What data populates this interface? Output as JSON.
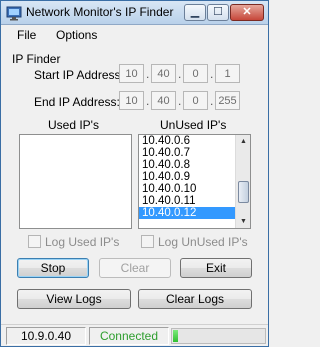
{
  "window": {
    "title": "Network Monitor's IP Finder"
  },
  "menu": {
    "file": "File",
    "options": "Options"
  },
  "ip_finder": {
    "group_label": "IP Finder",
    "start_label": "Start IP Address:",
    "end_label": "End IP Address:",
    "start_octets": [
      "10",
      "40",
      "0",
      "1"
    ],
    "end_octets": [
      "10",
      "40",
      "0",
      "255"
    ],
    "separator": "."
  },
  "used": {
    "label": "Used IP's",
    "items": []
  },
  "unused": {
    "label": "UnUsed IP's",
    "items": [
      "10.40.0.6",
      "10.40.0.7",
      "10.40.0.8",
      "10.40.0.9",
      "10.40.0.10",
      "10.40.0.11",
      "10.40.0.12"
    ],
    "selected": "10.40.0.12"
  },
  "checkboxes": {
    "log_used": "Log Used IP's",
    "log_unused": "Log UnUsed IP's"
  },
  "buttons": {
    "stop": "Stop",
    "clear": "Clear",
    "exit": "Exit",
    "view_logs": "View Logs",
    "clear_logs": "Clear Logs"
  },
  "status": {
    "local_ip": "10.9.0.40",
    "connection": "Connected",
    "connection_color": "#2e9e2e",
    "progress": 0.05
  },
  "title_buttons": {
    "minimize": "▁",
    "maximize": "☐",
    "close": "✕"
  }
}
